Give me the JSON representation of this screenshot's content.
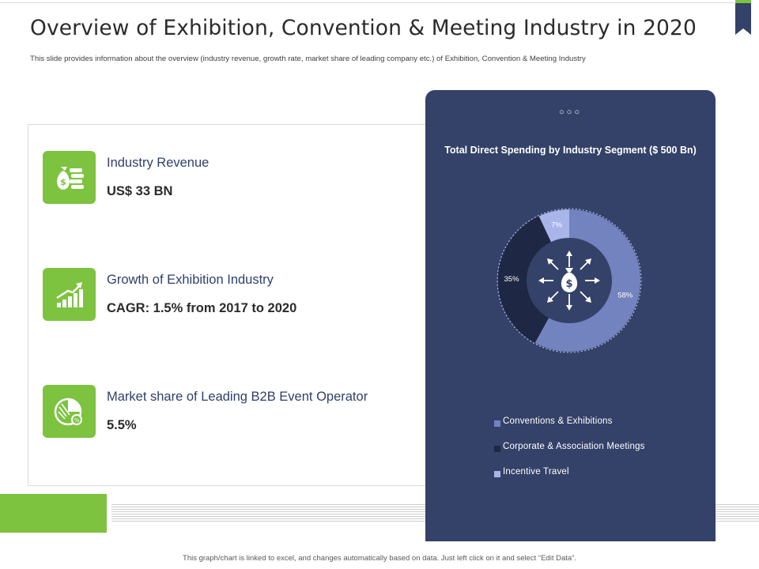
{
  "title": "Overview of Exhibition, Convention & Meeting Industry in 2020",
  "subtitle": "This slide provides information about the overview (industry revenue, growth rate, market share of leading company etc.) of Exhibition, Convention & Meeting Industry",
  "info_items": [
    {
      "label": "Industry Revenue",
      "value": "US$ 33 BN",
      "icon": "money-bag-coins-icon"
    },
    {
      "label": "Growth of Exhibition Industry",
      "value": "CAGR: 1.5% from 2017 to 2020",
      "icon": "growth-bar-chart-icon"
    },
    {
      "label": "Market share of Leading B2B Event Operator",
      "value": "5.5%",
      "icon": "pie-percent-icon"
    }
  ],
  "card_dots": "○○○",
  "chart_data": {
    "type": "pie",
    "title": "Total Direct Spending by Industry Segment ($ 500 Bn)",
    "categories": [
      "Conventions & Exhibitions",
      "Corporate & Association Meetings",
      "Incentive Travel"
    ],
    "values": [
      58,
      35,
      7
    ],
    "value_labels": [
      "58%",
      "35%",
      "7%"
    ],
    "colors": [
      "#7383c0",
      "#1e2743",
      "#a9b5e8"
    ],
    "center_icon": "money-bag-arrows-icon",
    "legend_position": "bottom"
  },
  "footer": "This graph/chart is linked to excel, and changes automatically based on data. Just left click on it and select “Edit Data”.",
  "colors": {
    "accent_green": "#7dc33f",
    "navy_card": "#344168",
    "label_navy": "#2f3f6a"
  }
}
